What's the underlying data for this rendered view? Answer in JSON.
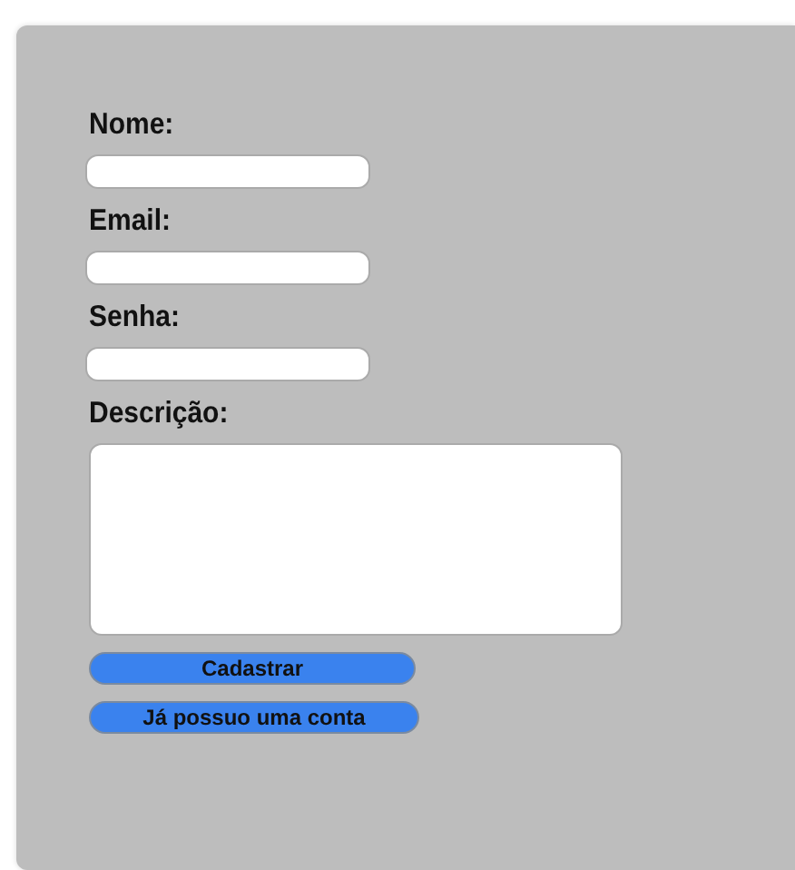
{
  "form": {
    "fields": [
      {
        "label": "Nome:",
        "kind": "input"
      },
      {
        "label": "Email:",
        "kind": "input"
      },
      {
        "label": "Senha:",
        "kind": "input"
      },
      {
        "label": "Descrição:",
        "kind": "textarea"
      }
    ],
    "buttons": [
      {
        "label": "Cadastrar",
        "kind": "submit"
      },
      {
        "label": "Já possuo uma conta",
        "kind": "link"
      }
    ]
  }
}
